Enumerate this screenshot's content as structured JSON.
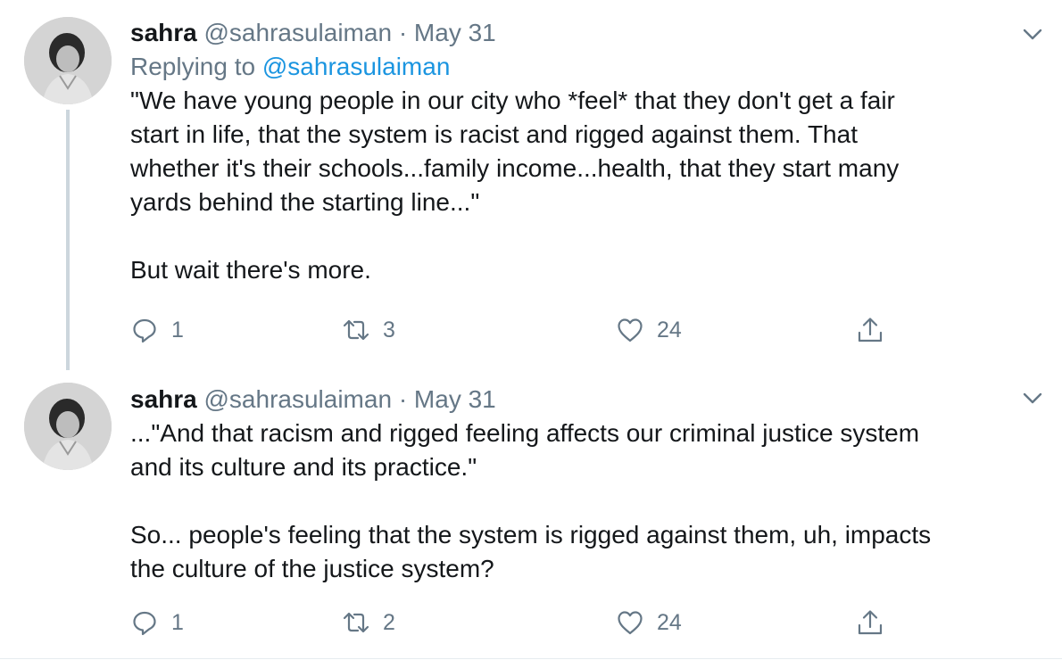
{
  "tweets": [
    {
      "name": "sahra",
      "handle": "@sahrasulaiman",
      "separator": "·",
      "date": "May 31",
      "replying_prefix": "Replying to ",
      "replying_to": "@sahrasulaiman",
      "text": "\"We have young people in our city who *feel* that they don't get a fair\nstart in life, that the system is racist and rigged against them. That\nwhether it's their schools...family income...health, that they start many\nyards behind the starting line...\"\n\nBut wait there's more.",
      "replies": "1",
      "retweets": "3",
      "likes": "24"
    },
    {
      "name": "sahra",
      "handle": "@sahrasulaiman",
      "separator": "·",
      "date": "May 31",
      "text": "...\"And that racism and rigged feeling affects our criminal justice system\nand its culture and its practice.\"\n\nSo... people's feeling that the system is rigged against them, uh, impacts\nthe culture of the justice system?",
      "replies": "1",
      "retweets": "2",
      "likes": "24"
    }
  ],
  "icons": {
    "reply": "reply-icon",
    "retweet": "retweet-icon",
    "like": "heart-icon",
    "share": "share-icon",
    "more": "chevron-down-icon",
    "avatar": "avatar"
  },
  "colors": {
    "text": "#14171a",
    "secondary": "#657786",
    "link": "#1b95e0",
    "thread_line": "#ccd6dd"
  }
}
